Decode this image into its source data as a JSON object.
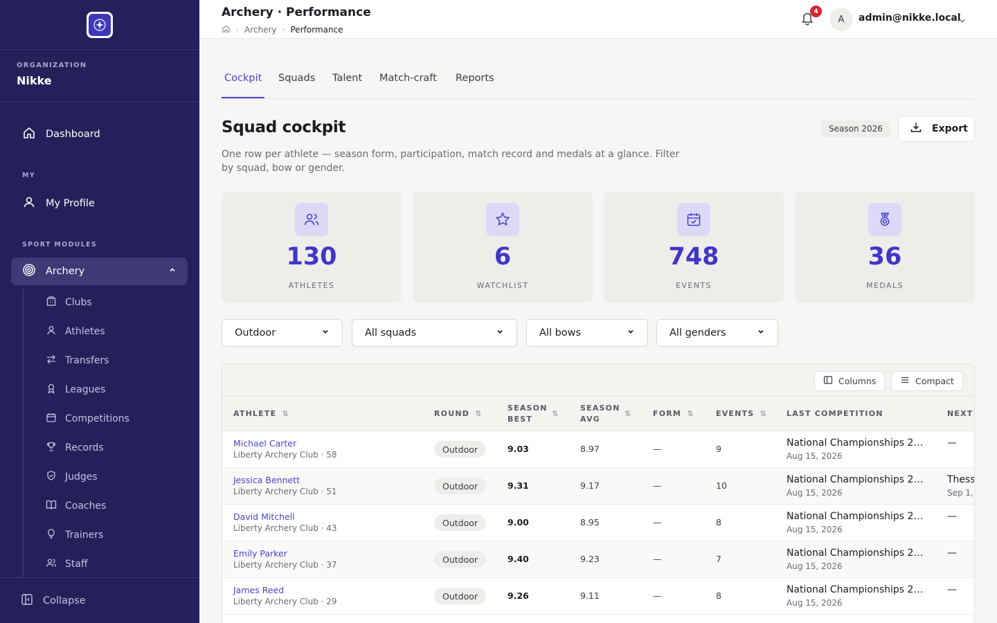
{
  "org": {
    "label": "ORGANIZATION",
    "name": "Nikke"
  },
  "nav": {
    "dashboard": "Dashboard",
    "my_section": "MY",
    "my_profile": "My Profile",
    "sport_section": "SPORT MODULES",
    "archery": "Archery",
    "sub_items": [
      "Clubs",
      "Athletes",
      "Transfers",
      "Leagues",
      "Competitions",
      "Records",
      "Judges",
      "Coaches",
      "Trainers",
      "Staff"
    ],
    "collapse": "Collapse"
  },
  "header": {
    "title": "Archery · Performance",
    "breadcrumb": [
      "Archery",
      "Performance"
    ],
    "notifications": "4",
    "avatar_initial": "A",
    "user": "admin@nikke.local"
  },
  "tabs": [
    "Cockpit",
    "Squads",
    "Talent",
    "Match-craft",
    "Reports"
  ],
  "page": {
    "title": "Squad cockpit",
    "description": "One row per athlete — season form, participation, match record and medals at a glance. Filter by squad, bow or gender.",
    "season": "Season 2026",
    "export": "Export"
  },
  "stats": [
    {
      "value": "130",
      "label": "ATHLETES",
      "icon": "users-icon"
    },
    {
      "value": "6",
      "label": "WATCHLIST",
      "icon": "star-icon"
    },
    {
      "value": "748",
      "label": "EVENTS",
      "icon": "calendar-check-icon"
    },
    {
      "value": "36",
      "label": "MEDALS",
      "icon": "medal-icon"
    }
  ],
  "filters": {
    "round": "Outdoor",
    "squad": "All squads",
    "bow": "All bows",
    "gender": "All genders"
  },
  "table_tools": {
    "columns": "Columns",
    "compact": "Compact"
  },
  "table": {
    "headers": [
      "ATHLETE",
      "ROUND",
      "SEASON BEST",
      "SEASON AVG",
      "FORM",
      "EVENTS",
      "LAST COMPETITION",
      "NEXT C"
    ],
    "rows": [
      {
        "name": "Michael Carter",
        "club": "Liberty Archery Club · 58",
        "round": "Outdoor",
        "best": "9.03",
        "avg": "8.97",
        "form": "—",
        "events": "9",
        "last": "National Championships 2…",
        "last_date": "Aug 15, 2026",
        "next": "—",
        "next_date": ""
      },
      {
        "name": "Jessica Bennett",
        "club": "Liberty Archery Club · 51",
        "round": "Outdoor",
        "best": "9.31",
        "avg": "9.17",
        "form": "—",
        "events": "10",
        "last": "National Championships 2…",
        "last_date": "Aug 15, 2026",
        "next": "Thess",
        "next_date": "Sep 1, 2"
      },
      {
        "name": "David Mitchell",
        "club": "Liberty Archery Club · 43",
        "round": "Outdoor",
        "best": "9.00",
        "avg": "8.95",
        "form": "—",
        "events": "8",
        "last": "National Championships 2…",
        "last_date": "Aug 15, 2026",
        "next": "—",
        "next_date": ""
      },
      {
        "name": "Emily Parker",
        "club": "Liberty Archery Club · 37",
        "round": "Outdoor",
        "best": "9.40",
        "avg": "9.23",
        "form": "—",
        "events": "7",
        "last": "National Championships 2…",
        "last_date": "Aug 15, 2026",
        "next": "—",
        "next_date": ""
      },
      {
        "name": "James Reed",
        "club": "Liberty Archery Club · 29",
        "round": "Outdoor",
        "best": "9.26",
        "avg": "9.11",
        "form": "—",
        "events": "8",
        "last": "National Championships 2…",
        "last_date": "Aug 15, 2026",
        "next": "—",
        "next_date": ""
      }
    ]
  },
  "colors": {
    "sidebar": "#24205a",
    "accent": "#4a42d0",
    "stat_number": "#3f36c8",
    "badge": "#d8262f"
  }
}
